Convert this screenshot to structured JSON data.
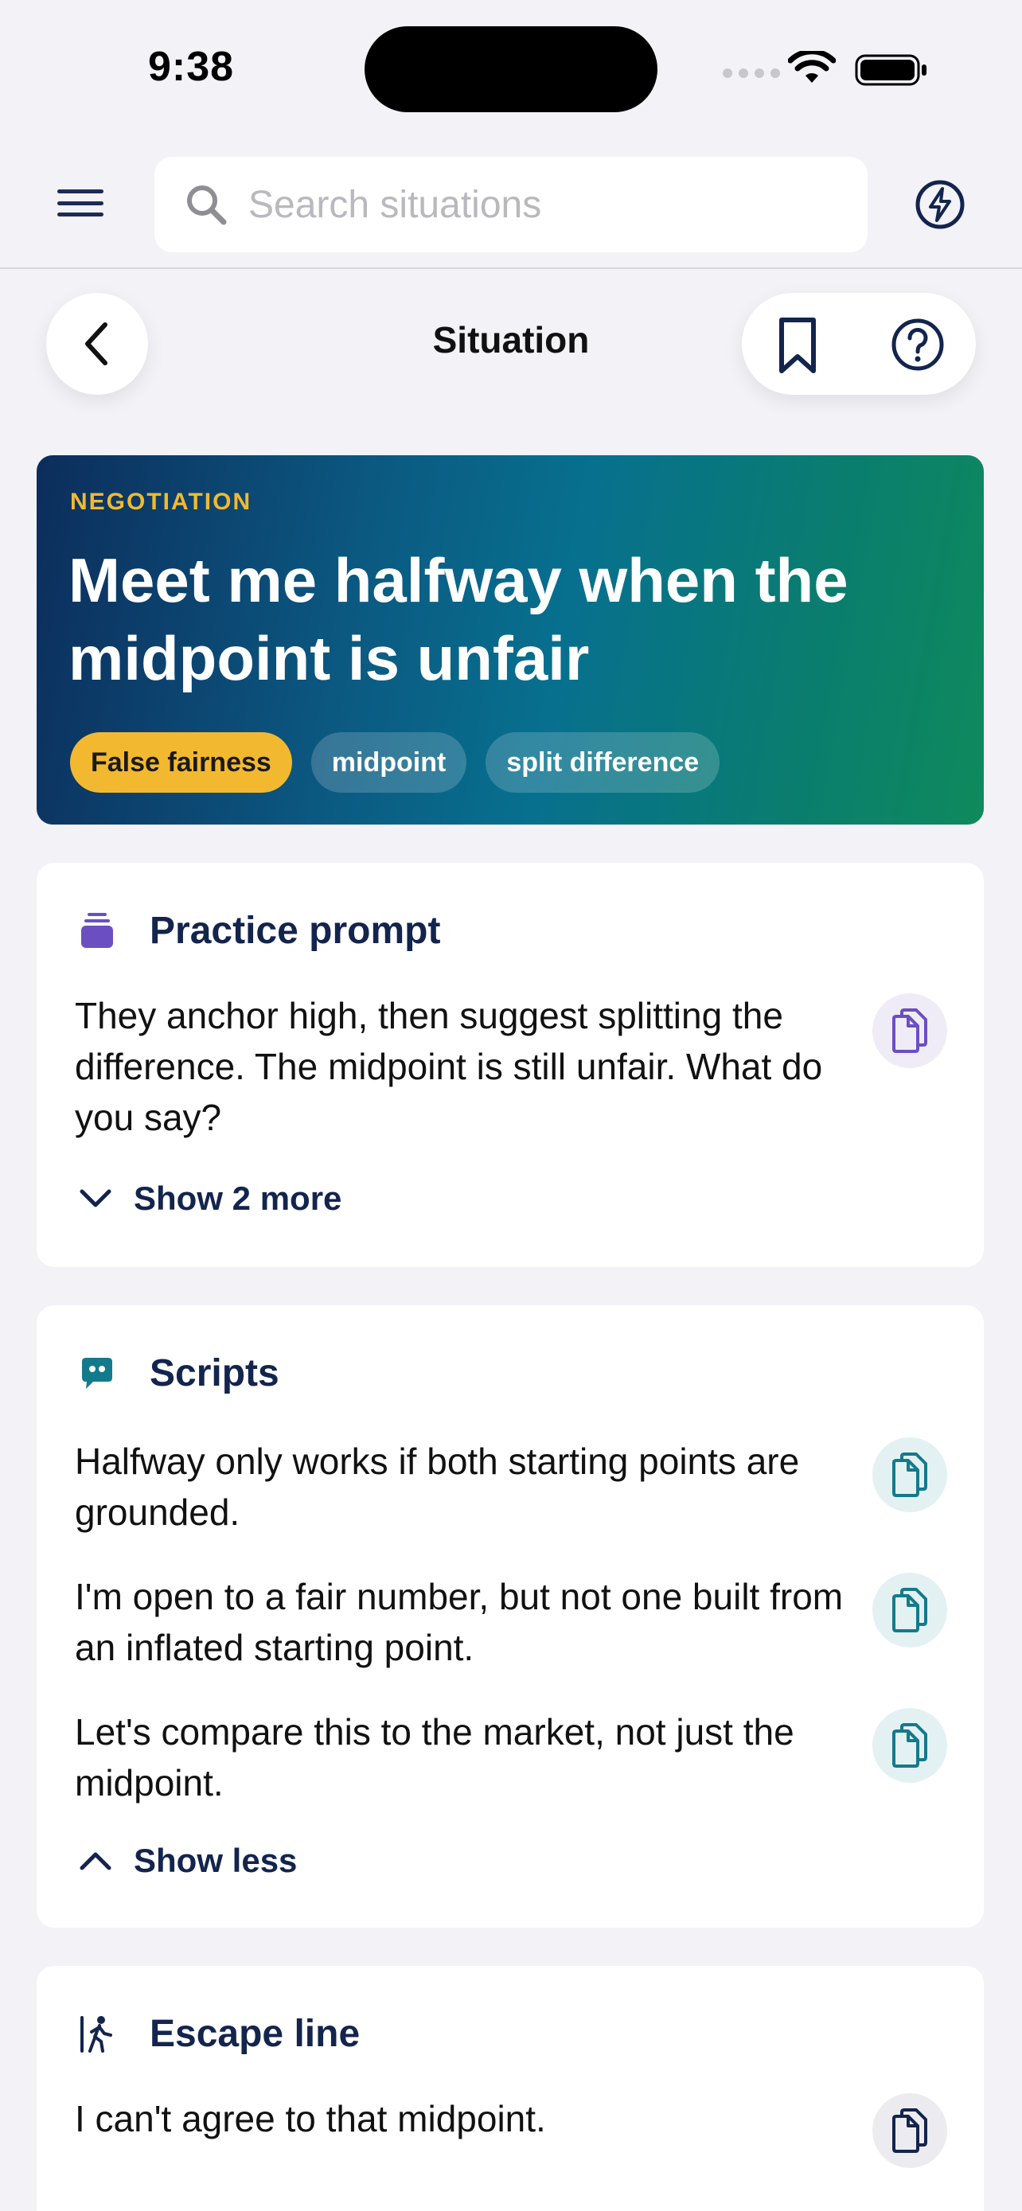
{
  "status_bar": {
    "time": "9:38"
  },
  "top_bar": {
    "search_placeholder": "Search situations"
  },
  "nav": {
    "title": "Situation"
  },
  "hero": {
    "category": "NEGOTIATION",
    "title": "Meet me halfway when the midpoint is unfair",
    "tags": [
      "False fairness",
      "midpoint",
      "split difference"
    ]
  },
  "practice": {
    "title": "Practice prompt",
    "prompt": "They anchor high, then suggest splitting the difference. The midpoint is still unfair. What do you say?",
    "toggle_label": "Show 2 more"
  },
  "scripts": {
    "title": "Scripts",
    "items": [
      "Halfway only works if both starting points are grounded.",
      "I'm open to a fair number, but not one built from an inflated starting point.",
      "Let's compare this to the market, not just the midpoint."
    ],
    "toggle_label": "Show less"
  },
  "escape": {
    "title": "Escape line",
    "text": "I can't agree to that midpoint."
  },
  "colors": {
    "accent_navy": "#13244d",
    "tag_gold": "#f2b930",
    "practice_purple": "#6b4fc2",
    "scripts_teal": "#137a8c"
  },
  "icons": [
    "menu-icon",
    "search-icon",
    "bolt-icon",
    "chevron-left-icon",
    "bookmark-icon",
    "help-icon",
    "stack-icon",
    "quote-bubble-icon",
    "walking-exit-icon",
    "copy-icon",
    "chevron-down-icon",
    "chevron-up-icon"
  ]
}
